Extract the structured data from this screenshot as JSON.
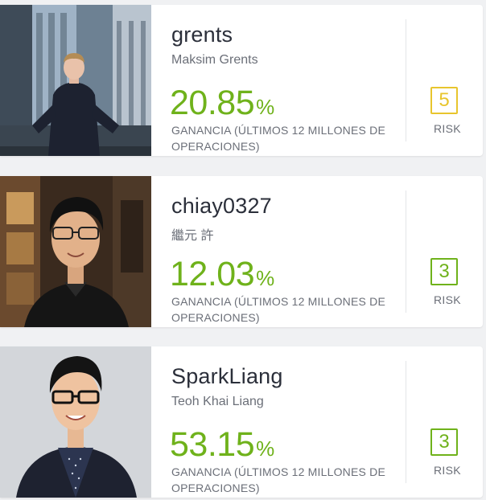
{
  "gain_label": "GANANCIA (ÚLTIMOS 12 MILLONES DE OPERACIONES)",
  "risk_label": "RISK",
  "percent_sign": "%",
  "colors": {
    "gain_green": "#6fb21b",
    "risk_green": "#6fb21b",
    "risk_yellow": "#e8c52d"
  },
  "traders": [
    {
      "username": "grents",
      "full_name": "Maksim Grents",
      "gain": "20.85",
      "risk": "5",
      "risk_color": "yellow"
    },
    {
      "username": "chiay0327",
      "full_name": "繼元 許",
      "gain": "12.03",
      "risk": "3",
      "risk_color": "green"
    },
    {
      "username": "SparkLiang",
      "full_name": "Teoh Khai Liang",
      "gain": "53.15",
      "risk": "3",
      "risk_color": "green"
    }
  ]
}
